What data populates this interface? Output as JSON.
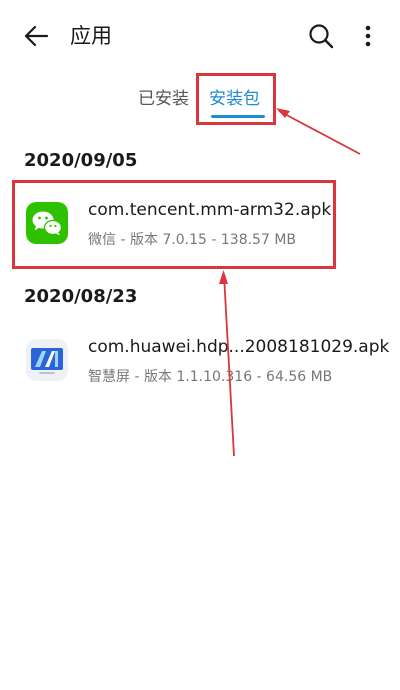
{
  "header": {
    "title": "应用",
    "back_icon": "arrow-left-icon",
    "search_icon": "search-icon",
    "more_icon": "more-vertical-icon"
  },
  "tabs": [
    {
      "label": "已安装",
      "active": false
    },
    {
      "label": "安装包",
      "active": true
    }
  ],
  "groups": [
    {
      "date": "2020/09/05",
      "items": [
        {
          "name": "com.tencent.mm-arm32.apk",
          "meta": "微信 - 版本 7.0.15 - 138.57 MB",
          "icon": "wechat-icon"
        }
      ]
    },
    {
      "date": "2020/08/23",
      "items": [
        {
          "name": "com.huawei.hdp...2008181029.apk",
          "meta": "智慧屏 - 版本 1.1.10.316 - 64.56 MB",
          "icon": "smart-screen-icon"
        }
      ]
    }
  ],
  "colors": {
    "accent": "#1e8bd6",
    "annotation": "#d9363e",
    "wechat_green": "#2dc100"
  }
}
